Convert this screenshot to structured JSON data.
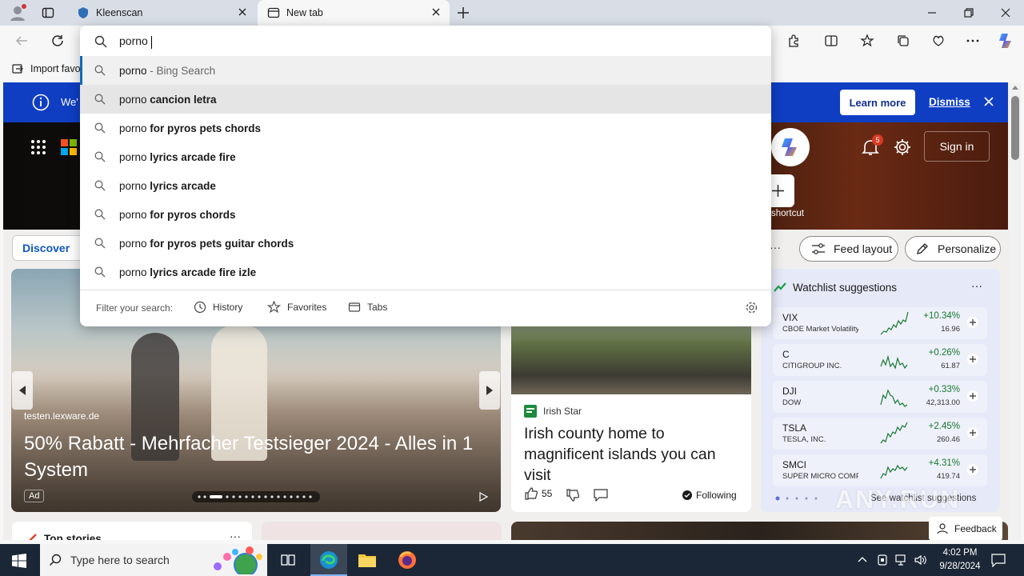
{
  "tabs": [
    {
      "title": "Kleenscan"
    },
    {
      "title": "New tab"
    }
  ],
  "address": {
    "value": "porno "
  },
  "favorites_bar": {
    "import_label": "Import favo"
  },
  "suggestions": [
    {
      "prefix": "porno",
      "rest": "",
      "suffix": " - Bing Search"
    },
    {
      "prefix": "porno ",
      "rest": "cancion letra",
      "suffix": ""
    },
    {
      "prefix": "porno ",
      "rest": "for pyros pets chords",
      "suffix": ""
    },
    {
      "prefix": "porno ",
      "rest": "lyrics arcade fire",
      "suffix": ""
    },
    {
      "prefix": "porno ",
      "rest": "lyrics arcade",
      "suffix": ""
    },
    {
      "prefix": "porno ",
      "rest": "for pyros chords",
      "suffix": ""
    },
    {
      "prefix": "porno ",
      "rest": "for pyros pets guitar chords",
      "suffix": ""
    },
    {
      "prefix": "porno ",
      "rest": "lyrics arcade fire izle",
      "suffix": ""
    }
  ],
  "filter": {
    "label": "Filter your search:",
    "history": "History",
    "favorites": "Favorites",
    "tabs": "Tabs"
  },
  "banner": {
    "text": "We'",
    "learn_more": "Learn more",
    "dismiss": "Dismiss"
  },
  "header": {
    "sign_in": "Sign in",
    "notifications": "5",
    "shortcut": "shortcut"
  },
  "nav": {
    "discover": "Discover",
    "feed_layout": "Feed layout",
    "personalize": "Personalize"
  },
  "feed": {
    "source": "testen.lexware.de",
    "headline": "50% Rabatt - Mehrfacher Testsieger 2024 - Alles in 1 System",
    "ad_label": "Ad"
  },
  "news": {
    "source": "Irish Star",
    "headline": "Irish county home to magnificent islands you can visit",
    "likes": "55",
    "following": "Following"
  },
  "watchlist": {
    "title": "Watchlist suggestions",
    "see_more": "See watchlist suggestions",
    "stocks": [
      {
        "symbol": "VIX",
        "name": "CBOE Market Volatility In...",
        "change": "+10.34%",
        "price": "16.96"
      },
      {
        "symbol": "C",
        "name": "CITIGROUP INC.",
        "change": "+0.26%",
        "price": "61.87"
      },
      {
        "symbol": "DJI",
        "name": "DOW",
        "change": "+0.33%",
        "price": "42,313.00"
      },
      {
        "symbol": "TSLA",
        "name": "TESLA, INC.",
        "change": "+2.45%",
        "price": "260.46"
      },
      {
        "symbol": "SMCI",
        "name": "SUPER MICRO COMPUTE...",
        "change": "+4.31%",
        "price": "419.74"
      }
    ]
  },
  "top_stories": {
    "title": "Top stories"
  },
  "feedback": {
    "label": "Feedback"
  },
  "watermark": "ANY.RUN",
  "taskbar": {
    "search_placeholder": "Type here to search",
    "time": "4:02 PM",
    "date": "9/28/2024"
  }
}
